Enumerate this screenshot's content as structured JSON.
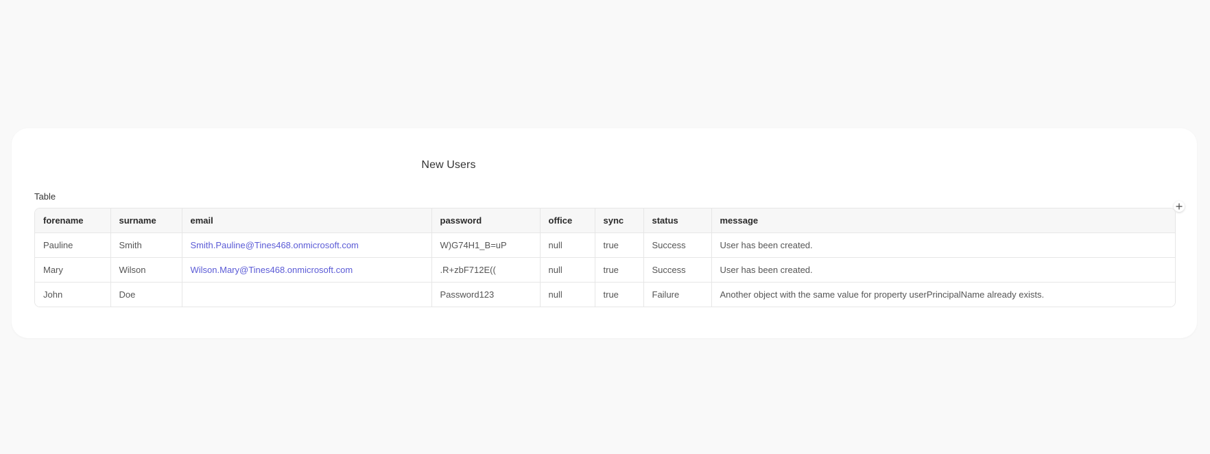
{
  "card": {
    "title": "New Users",
    "table_label": "Table"
  },
  "table": {
    "columns": [
      "forename",
      "surname",
      "email",
      "password",
      "office",
      "sync",
      "status",
      "message"
    ],
    "rows": [
      [
        "Pauline",
        "Smith",
        "Smith.Pauline@Tines468.onmicrosoft.com",
        "W)G74H1_B=uP",
        "null",
        "true",
        "Success",
        "User has been created."
      ],
      [
        "Mary",
        "Wilson",
        "Wilson.Mary@Tines468.onmicrosoft.com",
        ".R+zbF712E((",
        "null",
        "true",
        "Success",
        "User has been created."
      ],
      [
        "John",
        "Doe",
        "",
        "Password123",
        "null",
        "true",
        "Failure",
        "Another object with the same value for property userPrincipalName already exists."
      ]
    ]
  },
  "icons": {
    "add_column": "plus-icon"
  },
  "colors": {
    "link": "#5b5bd6",
    "background": "#f9f9f9",
    "card": "#ffffff"
  }
}
